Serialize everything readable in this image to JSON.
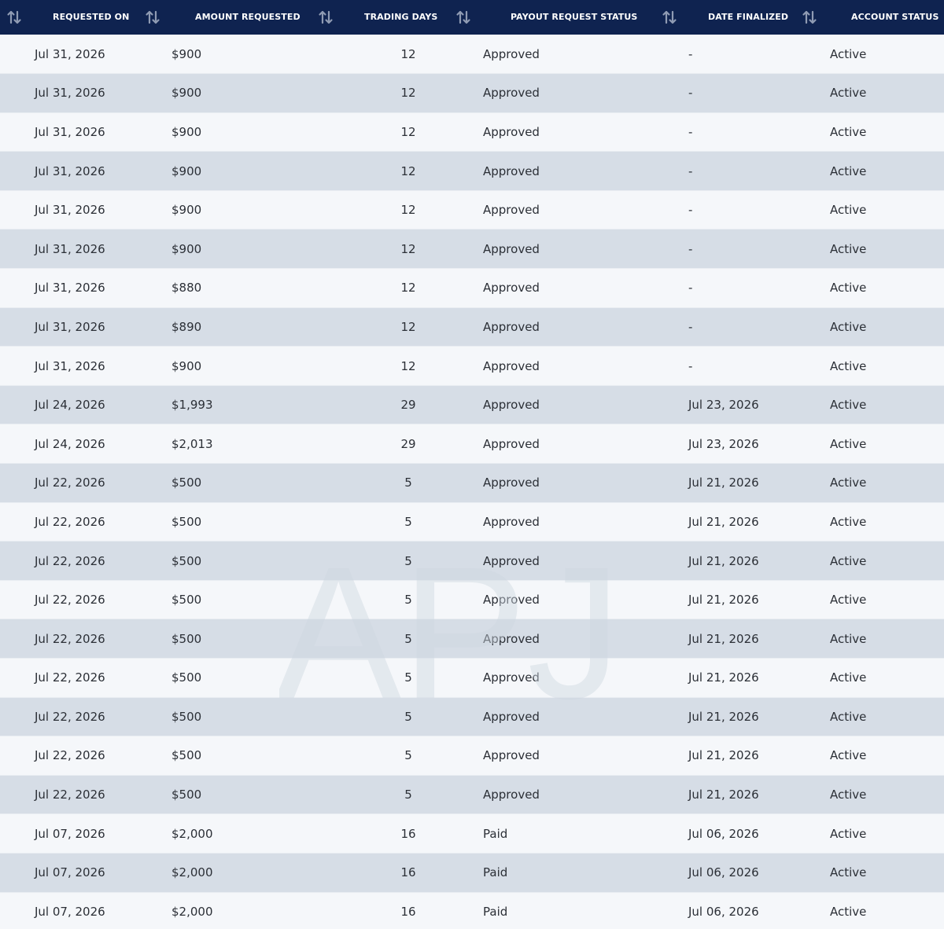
{
  "table": {
    "columns": [
      {
        "key": "requested_on",
        "label": "REQUESTED ON",
        "sort_icon": "sort-arrows-icon"
      },
      {
        "key": "amount_requested",
        "label": "AMOUNT REQUESTED",
        "sort_icon": "sort-arrows-icon"
      },
      {
        "key": "trading_days",
        "label": "TRADING DAYS",
        "sort_icon": "sort-arrows-icon"
      },
      {
        "key": "payout_request_status",
        "label": "PAYOUT REQUEST STATUS",
        "sort_icon": "sort-arrows-icon"
      },
      {
        "key": "date_finalized",
        "label": "DATE FINALIZED",
        "sort_icon": "sort-arrows-icon"
      },
      {
        "key": "account_status",
        "label": "ACCOUNT STATUS",
        "sort_icon": null
      }
    ],
    "rows": [
      {
        "requested_on": "Jul 31, 2026",
        "amount_requested": "$900",
        "trading_days": "12",
        "payout_request_status": "Approved",
        "date_finalized": "-",
        "account_status": "Active"
      },
      {
        "requested_on": "Jul 31, 2026",
        "amount_requested": "$900",
        "trading_days": "12",
        "payout_request_status": "Approved",
        "date_finalized": "-",
        "account_status": "Active"
      },
      {
        "requested_on": "Jul 31, 2026",
        "amount_requested": "$900",
        "trading_days": "12",
        "payout_request_status": "Approved",
        "date_finalized": "-",
        "account_status": "Active"
      },
      {
        "requested_on": "Jul 31, 2026",
        "amount_requested": "$900",
        "trading_days": "12",
        "payout_request_status": "Approved",
        "date_finalized": "-",
        "account_status": "Active"
      },
      {
        "requested_on": "Jul 31, 2026",
        "amount_requested": "$900",
        "trading_days": "12",
        "payout_request_status": "Approved",
        "date_finalized": "-",
        "account_status": "Active"
      },
      {
        "requested_on": "Jul 31, 2026",
        "amount_requested": "$900",
        "trading_days": "12",
        "payout_request_status": "Approved",
        "date_finalized": "-",
        "account_status": "Active"
      },
      {
        "requested_on": "Jul 31, 2026",
        "amount_requested": "$880",
        "trading_days": "12",
        "payout_request_status": "Approved",
        "date_finalized": "-",
        "account_status": "Active"
      },
      {
        "requested_on": "Jul 31, 2026",
        "amount_requested": "$890",
        "trading_days": "12",
        "payout_request_status": "Approved",
        "date_finalized": "-",
        "account_status": "Active"
      },
      {
        "requested_on": "Jul 31, 2026",
        "amount_requested": "$900",
        "trading_days": "12",
        "payout_request_status": "Approved",
        "date_finalized": "-",
        "account_status": "Active"
      },
      {
        "requested_on": "Jul 24, 2026",
        "amount_requested": "$1,993",
        "trading_days": "29",
        "payout_request_status": "Approved",
        "date_finalized": "Jul 23, 2026",
        "account_status": "Active"
      },
      {
        "requested_on": "Jul 24, 2026",
        "amount_requested": "$2,013",
        "trading_days": "29",
        "payout_request_status": "Approved",
        "date_finalized": "Jul 23, 2026",
        "account_status": "Active"
      },
      {
        "requested_on": "Jul 22, 2026",
        "amount_requested": "$500",
        "trading_days": "5",
        "payout_request_status": "Approved",
        "date_finalized": "Jul 21, 2026",
        "account_status": "Active"
      },
      {
        "requested_on": "Jul 22, 2026",
        "amount_requested": "$500",
        "trading_days": "5",
        "payout_request_status": "Approved",
        "date_finalized": "Jul 21, 2026",
        "account_status": "Active"
      },
      {
        "requested_on": "Jul 22, 2026",
        "amount_requested": "$500",
        "trading_days": "5",
        "payout_request_status": "Approved",
        "date_finalized": "Jul 21, 2026",
        "account_status": "Active"
      },
      {
        "requested_on": "Jul 22, 2026",
        "amount_requested": "$500",
        "trading_days": "5",
        "payout_request_status": "Approved",
        "date_finalized": "Jul 21, 2026",
        "account_status": "Active"
      },
      {
        "requested_on": "Jul 22, 2026",
        "amount_requested": "$500",
        "trading_days": "5",
        "payout_request_status": "Approved",
        "date_finalized": "Jul 21, 2026",
        "account_status": "Active"
      },
      {
        "requested_on": "Jul 22, 2026",
        "amount_requested": "$500",
        "trading_days": "5",
        "payout_request_status": "Approved",
        "date_finalized": "Jul 21, 2026",
        "account_status": "Active"
      },
      {
        "requested_on": "Jul 22, 2026",
        "amount_requested": "$500",
        "trading_days": "5",
        "payout_request_status": "Approved",
        "date_finalized": "Jul 21, 2026",
        "account_status": "Active"
      },
      {
        "requested_on": "Jul 22, 2026",
        "amount_requested": "$500",
        "trading_days": "5",
        "payout_request_status": "Approved",
        "date_finalized": "Jul 21, 2026",
        "account_status": "Active"
      },
      {
        "requested_on": "Jul 22, 2026",
        "amount_requested": "$500",
        "trading_days": "5",
        "payout_request_status": "Approved",
        "date_finalized": "Jul 21, 2026",
        "account_status": "Active"
      },
      {
        "requested_on": "Jul 07, 2026",
        "amount_requested": "$2,000",
        "trading_days": "16",
        "payout_request_status": "Paid",
        "date_finalized": "Jul 06, 2026",
        "account_status": "Active"
      },
      {
        "requested_on": "Jul 07, 2026",
        "amount_requested": "$2,000",
        "trading_days": "16",
        "payout_request_status": "Paid",
        "date_finalized": "Jul 06, 2026",
        "account_status": "Active"
      },
      {
        "requested_on": "Jul 07, 2026",
        "amount_requested": "$2,000",
        "trading_days": "16",
        "payout_request_status": "Paid",
        "date_finalized": "Jul 06, 2026",
        "account_status": "Active"
      }
    ]
  },
  "watermark": {
    "text": "APJ"
  },
  "colors": {
    "header_bg": "#0f2350",
    "header_text": "#ffffff",
    "row_light": "#f5f7fa",
    "row_dark": "#d6dde6",
    "body_text": "#2b2f36",
    "sort_icon": "#8f9bb3"
  }
}
